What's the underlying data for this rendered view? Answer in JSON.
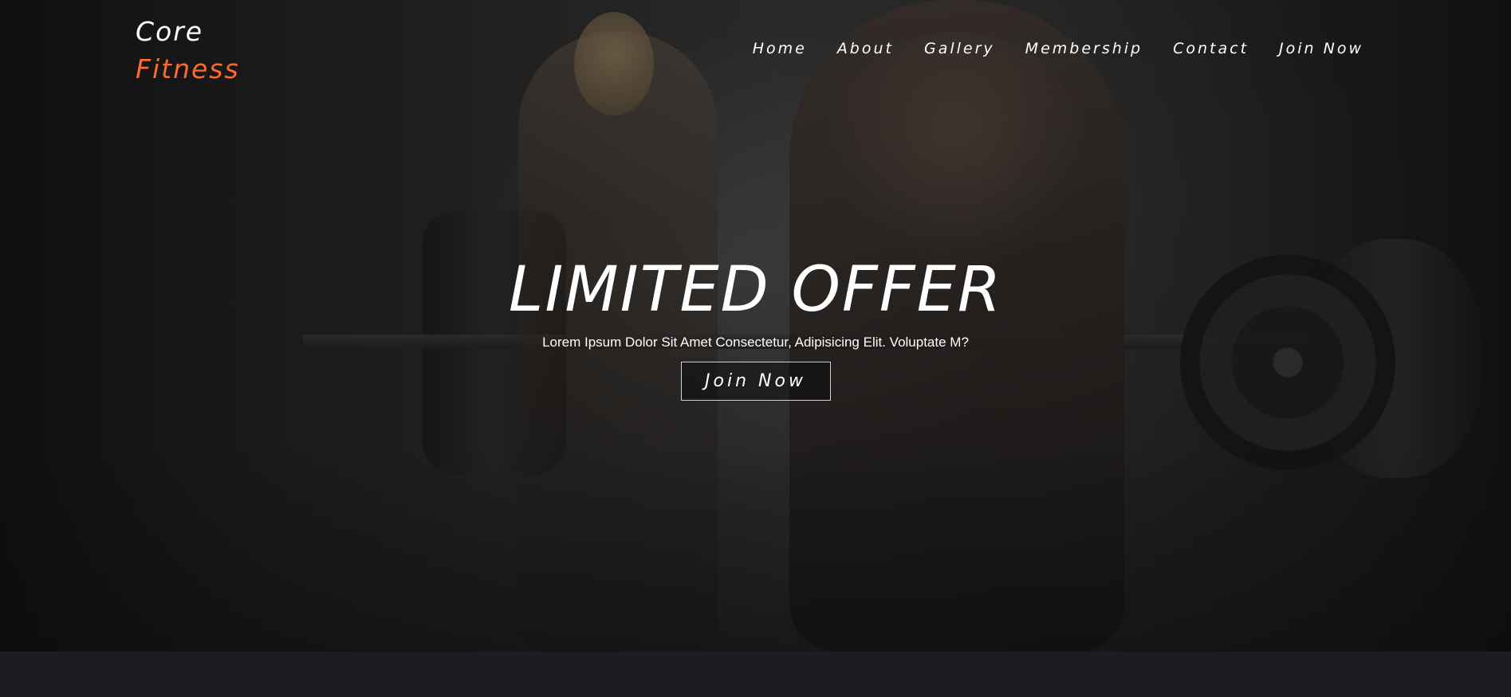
{
  "brand": {
    "line1": "Core",
    "line2": "Fitness",
    "accent_color": "#ff6a2b"
  },
  "nav": {
    "items": [
      {
        "label": "Home"
      },
      {
        "label": "About"
      },
      {
        "label": "Gallery"
      },
      {
        "label": "Membership"
      },
      {
        "label": "Contact"
      },
      {
        "label": "Join Now"
      }
    ]
  },
  "hero": {
    "title": "LIMITED OFFER",
    "subtitle": "Lorem Ipsum Dolor Sit Amet Consectetur, Adipisicing Elit. Voluptate M?",
    "cta_label": "Join Now"
  }
}
